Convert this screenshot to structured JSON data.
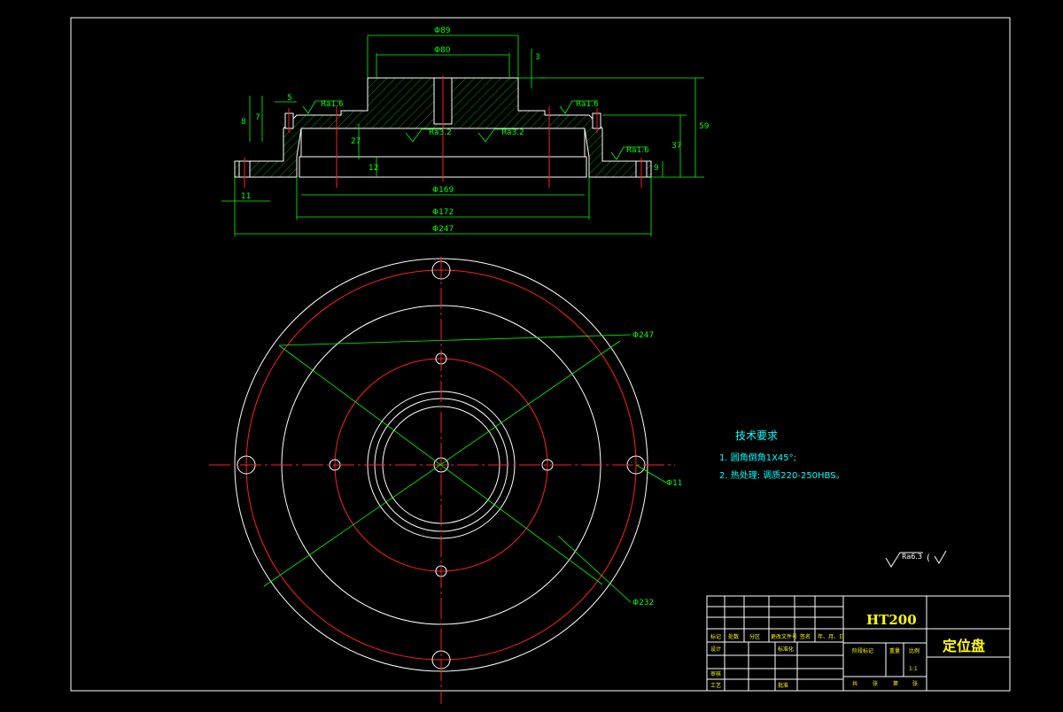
{
  "section_view": {
    "dims": {
      "d89": "Φ89",
      "d80": "Φ80",
      "d169": "Φ169",
      "d172": "Φ172",
      "d247": "Φ247",
      "v3": "3",
      "v5": "5",
      "v8": "8",
      "v7": "7",
      "v27": "27",
      "v12": "12",
      "v37": "37",
      "v59": "59",
      "v9": "9",
      "v11": "11"
    },
    "roughness": {
      "left_top": "Ra1.6",
      "right_top": "Ra1.6",
      "right_flange": "Ra1.6",
      "bore_left": "Ra3.2",
      "bore_right": "Ra3.2"
    }
  },
  "plan_view": {
    "callouts": {
      "outer": "Φ247",
      "bolt_circle": "Φ232",
      "hole": "Φ11"
    }
  },
  "tech_requirements": {
    "title": "技术要求",
    "items": [
      "1.  圆角倒角1X45°;",
      "2.  热处理: 调质220-250HBS。"
    ]
  },
  "general_roughness": {
    "value": "Ra6.3",
    "bracket": "("
  },
  "title_block": {
    "material": "HT200",
    "part_name": "定位盘",
    "row_labels": [
      "标记",
      "处数",
      "分区",
      "更改文件号",
      "签名",
      "年、月、日"
    ],
    "left_labels": [
      "设计",
      "审核",
      "工艺"
    ],
    "mid_labels": [
      "标准化",
      "批准"
    ],
    "stage_labels": [
      "阶段标记",
      "重量",
      "比例"
    ],
    "sheet_labels": [
      "共",
      "张",
      "第",
      "张"
    ],
    "scale_value": "1:1"
  }
}
